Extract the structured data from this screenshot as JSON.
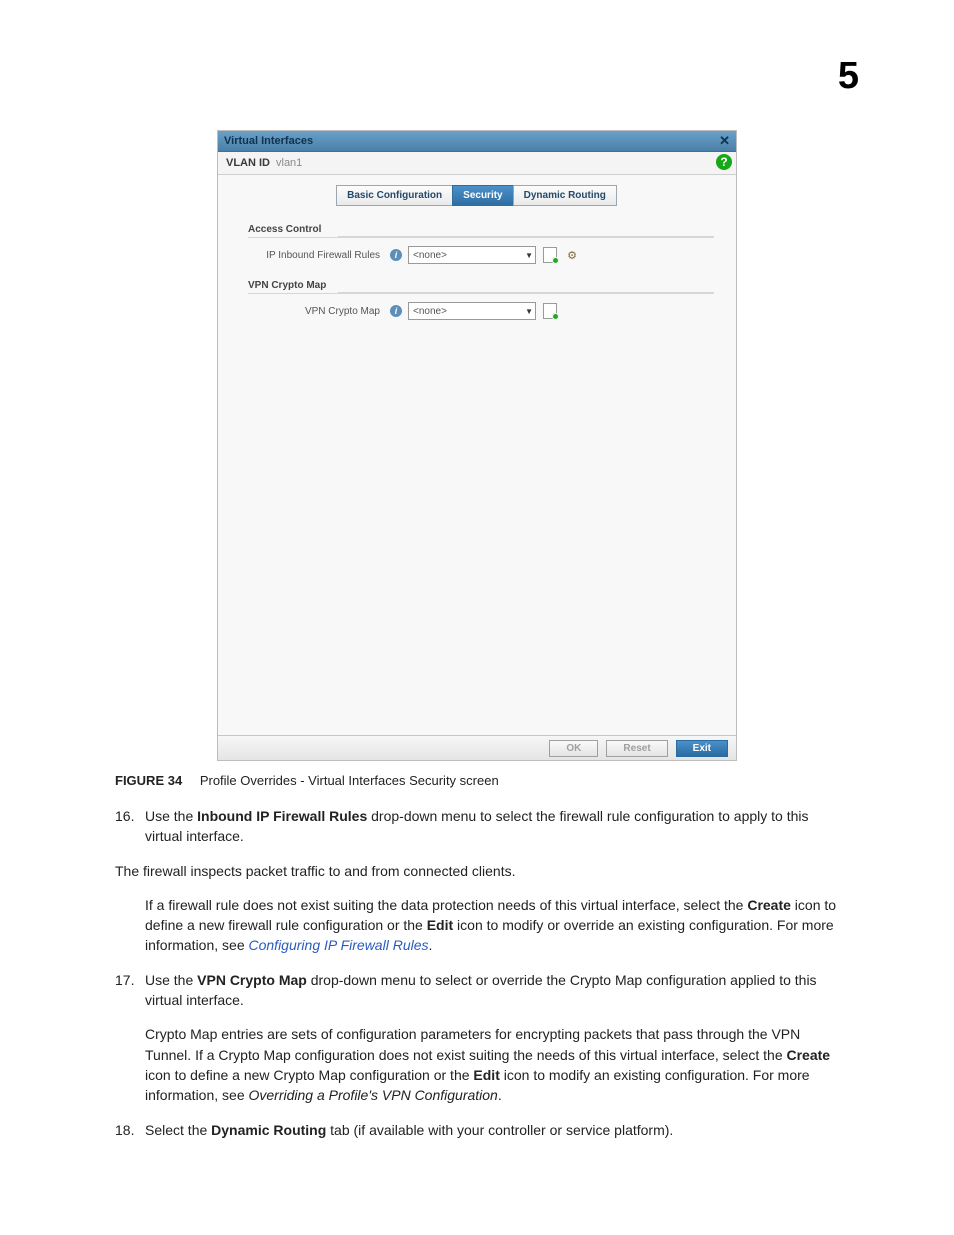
{
  "chapterNumber": "5",
  "screenshot": {
    "windowTitle": "Virtual Interfaces",
    "closeGlyph": "✕",
    "subbarLabel": "VLAN ID",
    "subbarValue": "vlan1",
    "helpGlyph": "?",
    "tabs": [
      "Basic Configuration",
      "Security",
      "Dynamic Routing"
    ],
    "sections": {
      "access": {
        "heading": "Access Control",
        "rowLabel": "IP Inbound Firewall Rules",
        "selected": "<none>"
      },
      "vpn": {
        "heading": "VPN Crypto Map",
        "rowLabel": "VPN Crypto Map",
        "selected": "<none>"
      }
    },
    "buttons": {
      "ok": "OK",
      "reset": "Reset",
      "exit": "Exit"
    },
    "arrowGlyph": "▼",
    "gearGlyph": "⚙"
  },
  "caption": {
    "lead": "FIGURE 34",
    "text": "Profile Overrides - Virtual Interfaces Security screen"
  },
  "steps": {
    "s16": {
      "num": "16.",
      "pre": "Use the ",
      "bold": "Inbound IP Firewall Rules",
      "post": " drop-down menu to select the firewall rule configuration to apply to this virtual interface."
    },
    "firewallLine": "The firewall inspects packet traffic to and from connected clients.",
    "s16b": {
      "line1": "If a firewall rule does not exist suiting the data protection needs of this virtual interface, select the ",
      "createBold": "Create",
      "mid": " icon to define a new firewall rule configuration or the ",
      "editBold": "Edit",
      "after": " icon to modify or override an existing configuration. For more information, see ",
      "link": "Configuring IP Firewall Rules",
      "period": "."
    },
    "s17": {
      "num": "17.",
      "pre": "Use the ",
      "bold": "VPN Crypto Map",
      "post": " drop-down menu to select or override the Crypto Map configuration applied to this virtual interface."
    },
    "s17b": {
      "a": "Crypto Map entries are sets of configuration parameters for encrypting packets that pass through the VPN Tunnel. If a Crypto Map configuration does not exist suiting the needs of this virtual interface, select the ",
      "create": "Create",
      "b": " icon to define a new Crypto Map configuration or the ",
      "edit": "Edit",
      "c": " icon to modify an existing configuration. For more information, see ",
      "italic": "Overriding a Profile's VPN Configuration",
      "d": "."
    },
    "s18": {
      "num": "18.",
      "pre": "Select the ",
      "bold": "Dynamic Routing",
      "post": " tab (if available with your controller or service platform)."
    }
  }
}
